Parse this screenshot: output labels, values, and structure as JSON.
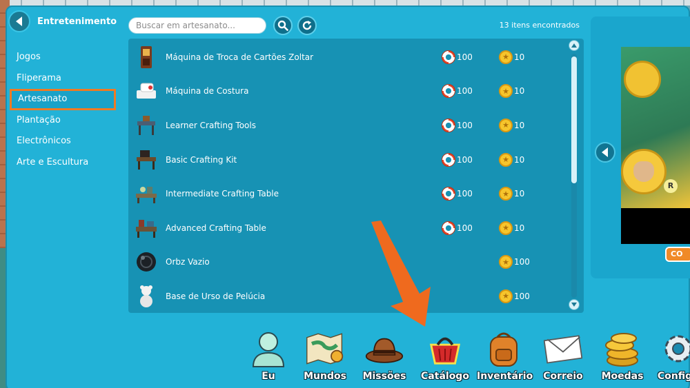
{
  "sidebar": {
    "title": "Entretenimento",
    "back_icon": "chevron-left-icon",
    "items": [
      {
        "label": "Jogos"
      },
      {
        "label": "Fliperama"
      },
      {
        "label": "Artesanato"
      },
      {
        "label": "Plantação"
      },
      {
        "label": "Electrônicos"
      },
      {
        "label": "Arte e Escultura"
      }
    ],
    "active_index": 2
  },
  "toolbar": {
    "search_placeholder": "Buscar em artesanato...",
    "search_icon": "search-icon",
    "refresh_icon": "refresh-icon",
    "count_text": "13 itens encontrados"
  },
  "items": [
    {
      "name": "Máquina de Troca de Cartões Zoltar",
      "price_lifering": "100",
      "price_coins": "10",
      "icon": "zoltar-machine-icon"
    },
    {
      "name": "Máquina de Costura",
      "price_lifering": "100",
      "price_coins": "10",
      "icon": "sewing-machine-icon"
    },
    {
      "name": "Learner Crafting Tools",
      "price_lifering": "100",
      "price_coins": "10",
      "icon": "crafting-tools-icon"
    },
    {
      "name": "Basic Crafting Kit",
      "price_lifering": "100",
      "price_coins": "10",
      "icon": "crafting-kit-icon"
    },
    {
      "name": "Intermediate Crafting Table",
      "price_lifering": "100",
      "price_coins": "10",
      "icon": "crafting-table-icon"
    },
    {
      "name": "Advanced Crafting Table",
      "price_lifering": "100",
      "price_coins": "10",
      "icon": "advanced-table-icon"
    },
    {
      "name": "Orbz Vazio",
      "price_lifering": "",
      "price_coins": "100",
      "icon": "orb-icon"
    },
    {
      "name": "Base de Urso de Pelúcia",
      "price_lifering": "",
      "price_coins": "100",
      "icon": "teddy-bear-icon"
    }
  ],
  "banner": {
    "badge": "R",
    "button_label": "CO"
  },
  "dock": [
    {
      "label": "Eu",
      "icon": "avatar-icon"
    },
    {
      "label": "Mundos",
      "icon": "map-icon"
    },
    {
      "label": "Missões",
      "icon": "hat-icon"
    },
    {
      "label": "Catálogo",
      "icon": "basket-icon"
    },
    {
      "label": "Inventário",
      "icon": "backpack-icon"
    },
    {
      "label": "Correio",
      "icon": "envelope-icon"
    },
    {
      "label": "Moedas",
      "icon": "coins-icon"
    },
    {
      "label": "Configu",
      "icon": "gear-icon"
    }
  ],
  "colors": {
    "panel": "#22b2d7",
    "list_bg": "#1792b4",
    "active_border": "#f07a22",
    "arrow": "#ef6a1e"
  }
}
